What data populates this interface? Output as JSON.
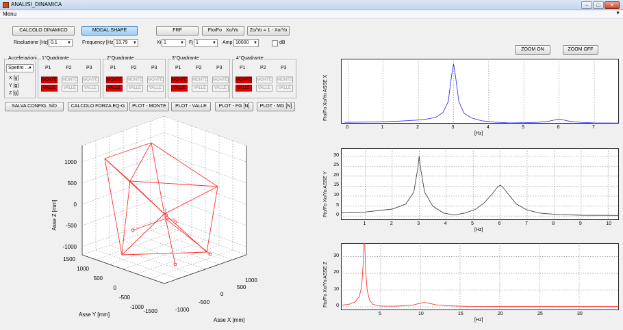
{
  "window": {
    "title": "ANALISI_DINAMICA",
    "menu": "Menu"
  },
  "toolbar": {
    "calcolo_dinamico": "CALCOLO DINAMICO",
    "modal_shape": "MODAL SHAPE",
    "frf": "FRF",
    "fto_fo": "Fto/Fo",
    "xo_yo": "Xo/Yo",
    "zo_yo": "Zo/Yo = 1 - Xo/Yo",
    "risoluzione_label": "Risoluzione [Hz]",
    "risoluzione_value": "0.1",
    "frequency_label": "Frequency [Hz]",
    "frequency_value": "13.79",
    "xi_label": "Xi",
    "xi_value": "1",
    "fj_label": "Fj",
    "fj_value": "1",
    "amp_label": "Amp",
    "amp_value": "10000",
    "db_label": "dB",
    "zoom_on": "ZOOM ON",
    "zoom_off": "ZOOM OFF"
  },
  "accel": {
    "title": "Accelerazioni",
    "mode": "Spettro ...",
    "rows": [
      "X [g]",
      "Y [g]",
      "Z [g]"
    ]
  },
  "quadrants": [
    {
      "title": "1°Quadrante",
      "cols": [
        "P1",
        "P2",
        "P3"
      ]
    },
    {
      "title": "2°Quadrante",
      "cols": [
        "P1",
        "P2",
        "P3"
      ]
    },
    {
      "title": "3°Quadrante",
      "cols": [
        "P1",
        "P2",
        "P3"
      ]
    },
    {
      "title": "4°Quadrante",
      "cols": [
        "P1",
        "P2",
        "P3"
      ]
    }
  ],
  "cells": {
    "monte": "MONTE",
    "valle": "VALLE"
  },
  "actions": {
    "salva": "SALVA CONFIG. S/D",
    "calcolo_forza": "CALCOLO FORZA EQ-G",
    "plot_monte": "PLOT - MONTE",
    "plot_valle": "PLOT - VALLE",
    "plot_fg": "PLOT - FG [N]",
    "plot_mg": "PLOT - MG [N]"
  },
  "plot3d": {
    "zlabel": "Asse Z [mm]",
    "ylabel": "Asse Y [mm]",
    "xlabel": "Asse X [mm]",
    "zticks": [
      "1000",
      "500",
      "0",
      "-500",
      "-1000"
    ],
    "yticks": [
      "1500",
      "1000",
      "500",
      "0",
      "-500",
      "-1000",
      "-1500"
    ],
    "xticks": [
      "-1000",
      "-500",
      "0",
      "500",
      "1000"
    ]
  },
  "colors": {
    "blue": "#3030ff",
    "black": "#404040",
    "red": "#ff3030",
    "cell_on": "#e00000"
  },
  "chart_data": [
    {
      "type": "line",
      "ylabel": "Fto/Fo  Xo/Yo ASSE X",
      "xlabel": "[Hz]",
      "xlim": [
        -0.2,
        7.7
      ],
      "ylim": [
        0,
        50
      ],
      "xticks": [
        0,
        1,
        2,
        3,
        4,
        5,
        6,
        7
      ],
      "yticks": [],
      "series": [
        {
          "color": "#3030ff",
          "x": [
            -0.1,
            0.5,
            1.0,
            1.5,
            2.0,
            2.3,
            2.5,
            2.7,
            2.85,
            2.95,
            3.0,
            3.05,
            3.15,
            3.3,
            3.5,
            3.8,
            4.2,
            4.6,
            5.0,
            5.4,
            5.7,
            5.9,
            6.0,
            6.1,
            6.3,
            6.6,
            7.0,
            7.7
          ],
          "y": [
            1.0,
            1.2,
            1.5,
            2.0,
            2.8,
            3.8,
            5.0,
            8.5,
            17,
            38,
            46,
            38,
            17,
            8,
            4.5,
            2.2,
            1.1,
            0.6,
            0.7,
            1.0,
            1.8,
            3.0,
            3.6,
            3.0,
            1.8,
            1.0,
            0.6,
            0.4
          ]
        }
      ]
    },
    {
      "type": "line",
      "ylabel": "Fto/Fo  Xo/Yo ASSE Y",
      "xlabel": "[Hz]",
      "xlim": [
        0.1,
        10.4
      ],
      "ylim": [
        -2,
        34
      ],
      "xticks": [
        1,
        2,
        3,
        4,
        5,
        6,
        7,
        8,
        9,
        10
      ],
      "yticks": [
        0,
        5,
        10,
        15,
        20,
        25,
        30
      ],
      "series": [
        {
          "color": "#404040",
          "x": [
            0.1,
            1.0,
            2.0,
            2.5,
            2.8,
            2.95,
            3.0,
            3.05,
            3.2,
            3.5,
            3.9,
            4.3,
            4.7,
            5.1,
            5.4,
            5.7,
            5.9,
            6.0,
            6.1,
            6.3,
            6.6,
            7.0,
            7.5,
            8.2,
            9.0,
            10.4
          ],
          "y": [
            1.5,
            2.0,
            3.5,
            6,
            12,
            24,
            30,
            24,
            12,
            5,
            1.5,
            0.5,
            1.5,
            3.5,
            6.5,
            11,
            14.5,
            15.5,
            14.5,
            11,
            6,
            3,
            1.4,
            0.7,
            0.4,
            0.3
          ]
        }
      ]
    },
    {
      "type": "line",
      "ylabel": "Fto/Fo  Xo/Yo ASSE Z",
      "xlabel": "[Hz]",
      "xlim": [
        0,
        35
      ],
      "ylim": [
        -2,
        38
      ],
      "xticks": [
        5,
        10,
        15,
        20,
        25,
        30
      ],
      "yticks": [
        0,
        10,
        20,
        30
      ],
      "series": [
        {
          "color": "#ff3030",
          "x": [
            0,
            1.0,
            1.8,
            2.3,
            2.6,
            2.8,
            2.9,
            3.0,
            3.1,
            3.3,
            3.6,
            4.0,
            5.0,
            7.0,
            9.0,
            10.0,
            10.5,
            11.0,
            12.0,
            13.5,
            16,
            20,
            25,
            30,
            35
          ],
          "y": [
            1.0,
            1.5,
            3,
            6,
            12,
            26,
            38,
            38,
            22,
            10,
            4,
            1.5,
            0.5,
            0.4,
            1.0,
            2.2,
            2.6,
            2.2,
            1.2,
            0.6,
            0.3,
            0.2,
            0.2,
            0.2,
            0.2
          ]
        }
      ]
    }
  ]
}
